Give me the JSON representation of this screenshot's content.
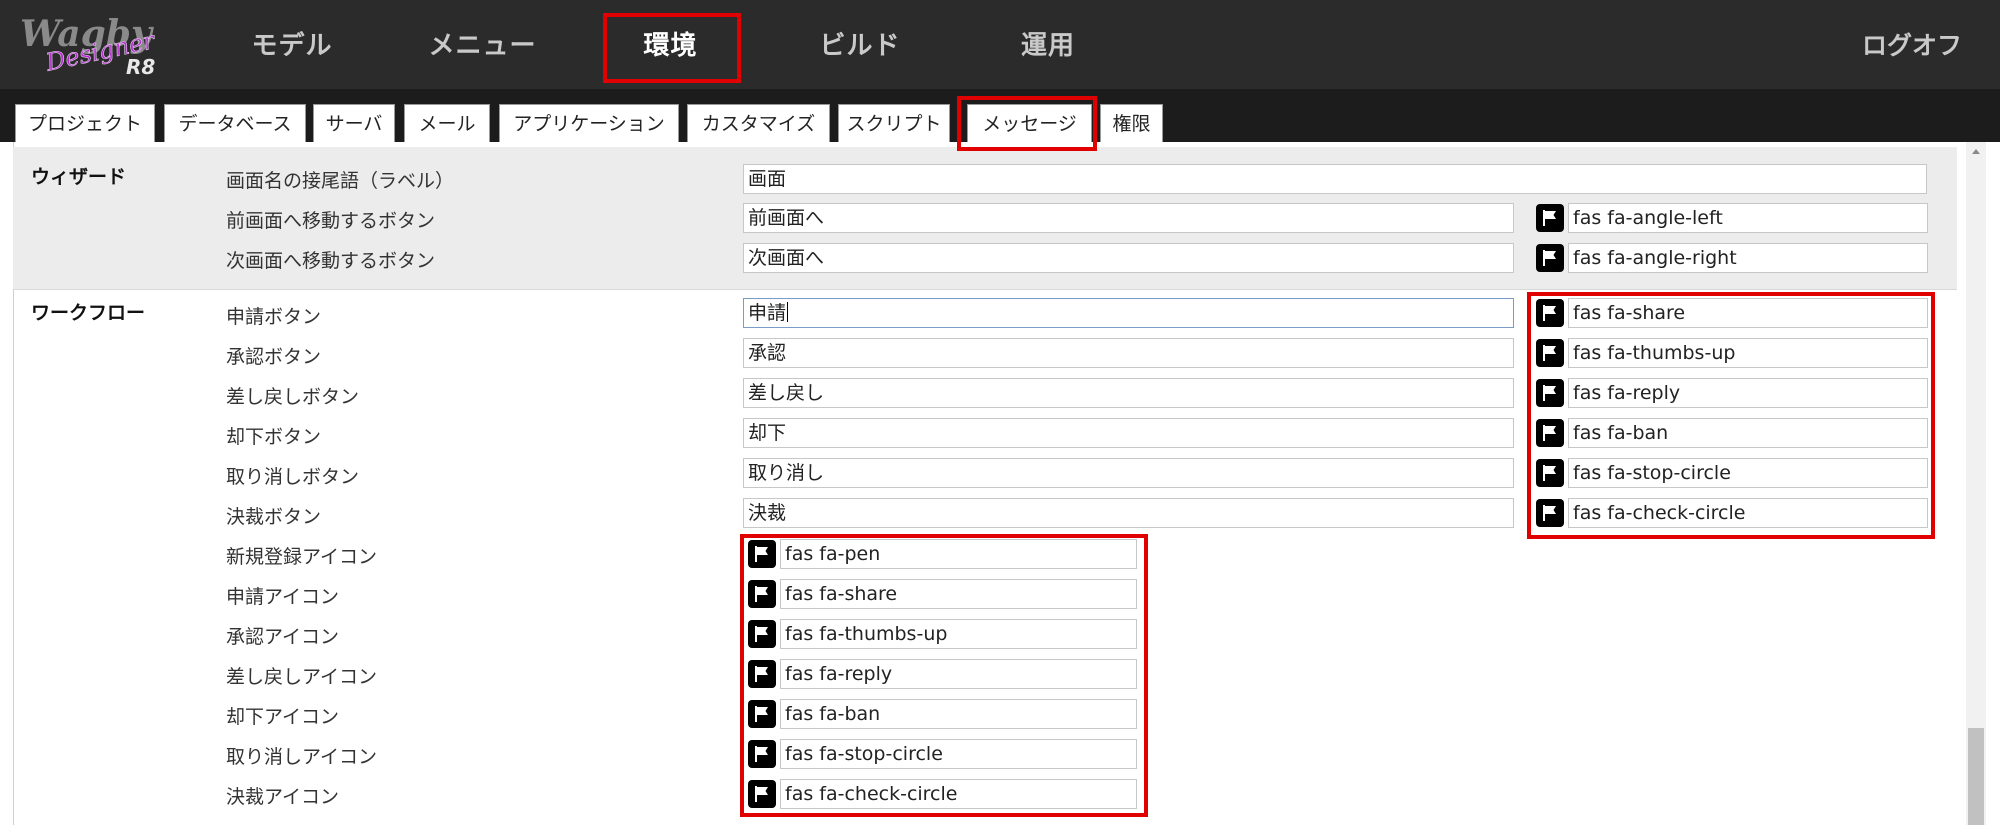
{
  "logo": {
    "text_main": "Wagby",
    "text_script": "Designer",
    "text_version": "R8"
  },
  "nav": {
    "items": [
      {
        "label": "モデル"
      },
      {
        "label": "メニュー"
      },
      {
        "label": "環境"
      },
      {
        "label": "ビルド"
      },
      {
        "label": "運用"
      }
    ],
    "logoff": "ログオフ",
    "active": "環境"
  },
  "tabs": [
    {
      "label": "プロジェクト"
    },
    {
      "label": "データベース"
    },
    {
      "label": "サーバ"
    },
    {
      "label": "メール"
    },
    {
      "label": "アプリケーション"
    },
    {
      "label": "カスタマイズ"
    },
    {
      "label": "スクリプト"
    },
    {
      "label": "メッセージ"
    },
    {
      "label": "権限"
    }
  ],
  "active_tab": "メッセージ",
  "wizard": {
    "title": "ウィザード",
    "rows": [
      {
        "label": "画面名の接尾語（ラベル）",
        "value": "画面"
      },
      {
        "label": "前画面へ移動するボタン",
        "value": "前画面へ",
        "icon": "fas fa-angle-left"
      },
      {
        "label": "次画面へ移動するボタン",
        "value": "次画面へ",
        "icon": "fas fa-angle-right"
      }
    ]
  },
  "workflow": {
    "title": "ワークフロー",
    "button_rows": [
      {
        "label": "申請ボタン",
        "value": "申請",
        "icon": "fas fa-share"
      },
      {
        "label": "承認ボタン",
        "value": "承認",
        "icon": "fas fa-thumbs-up"
      },
      {
        "label": "差し戻しボタン",
        "value": "差し戻し",
        "icon": "fas fa-reply"
      },
      {
        "label": "却下ボタン",
        "value": "却下",
        "icon": "fas fa-ban"
      },
      {
        "label": "取り消しボタン",
        "value": "取り消し",
        "icon": "fas fa-stop-circle"
      },
      {
        "label": "決裁ボタン",
        "value": "決裁",
        "icon": "fas fa-check-circle"
      }
    ],
    "icon_rows": [
      {
        "label": "新規登録アイコン",
        "icon": "fas fa-pen"
      },
      {
        "label": "申請アイコン",
        "icon": "fas fa-share"
      },
      {
        "label": "承認アイコン",
        "icon": "fas fa-thumbs-up"
      },
      {
        "label": "差し戻しアイコン",
        "icon": "fas fa-reply"
      },
      {
        "label": "却下アイコン",
        "icon": "fas fa-ban"
      },
      {
        "label": "取り消しアイコン",
        "icon": "fas fa-stop-circle"
      },
      {
        "label": "決裁アイコン",
        "icon": "fas fa-check-circle"
      }
    ]
  },
  "icons": {
    "picker": "flag-icon"
  },
  "colors": {
    "header_bg": "#2b2b2b",
    "tabbar_bg": "#1c1c1c",
    "highlight": "#e10000",
    "logo_purple": "#b030c8"
  }
}
